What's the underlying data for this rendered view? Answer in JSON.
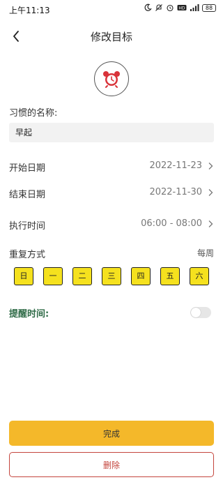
{
  "status_bar": {
    "time": "上午11:13",
    "battery": "88",
    "icons": [
      "moon-icon",
      "notifications-off-icon",
      "alarm-icon",
      "hd-icon",
      "signal-icon",
      "battery-icon"
    ]
  },
  "header": {
    "title": "修改目标",
    "back_icon": "back-arrow-icon"
  },
  "habit": {
    "icon": "alarm-clock-icon",
    "icon_color": "#d9333a",
    "name_label": "习惯的名称:",
    "name_value": "早起"
  },
  "rows": [
    {
      "label": "开始日期",
      "value": "2022-11-23"
    },
    {
      "label": "结束日期",
      "value": "2022-11-30"
    },
    {
      "label": "执行时间",
      "value": "06:00 - 08:00"
    }
  ],
  "repeat": {
    "label": "重复方式",
    "value": "每周",
    "days": [
      "日",
      "一",
      "二",
      "三",
      "四",
      "五",
      "六"
    ],
    "day_color": "#f5e11e"
  },
  "reminder": {
    "label": "提醒时间:",
    "enabled": false,
    "label_color": "#2f6b47"
  },
  "actions": {
    "done_label": "完成",
    "done_color": "#f4b82a",
    "delete_label": "删除",
    "delete_color": "#c4453d"
  }
}
